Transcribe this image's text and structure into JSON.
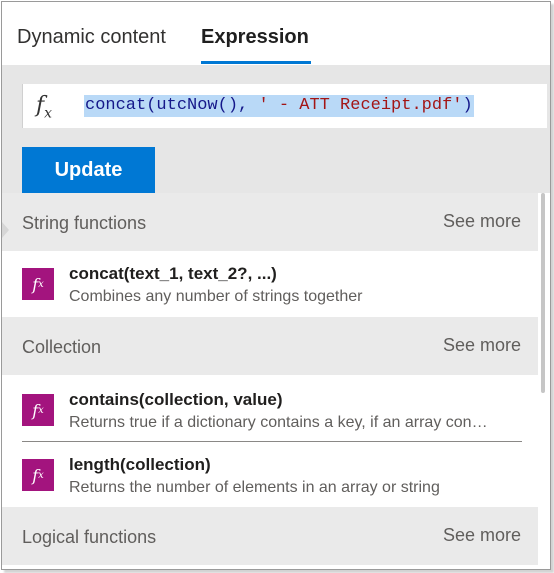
{
  "tabs": {
    "dynamic_content": "Dynamic content",
    "expression": "Expression",
    "active": "Expression"
  },
  "expression_editor": {
    "icon": "fx-icon",
    "value": "concat(utcNow(), ' - ATT Receipt.pdf')",
    "tokens": {
      "fn": "concat(utcNow(), ",
      "str": "' - ATT Receipt.pdf'",
      "close": ")"
    },
    "selected": true
  },
  "update_button": {
    "label": "Update"
  },
  "sections": [
    {
      "title": "String functions",
      "see_more": "See more",
      "items": [
        {
          "name": "concat(text_1, text_2?, ...)",
          "description": "Combines any number of strings together"
        }
      ]
    },
    {
      "title": "Collection",
      "see_more": "See more",
      "items": [
        {
          "name": "contains(collection, value)",
          "description": "Returns true if a dictionary contains a key, if an array con…"
        },
        {
          "name": "length(collection)",
          "description": "Returns the number of elements in an array or string"
        }
      ]
    },
    {
      "title": "Logical functions",
      "see_more": "See more",
      "items": []
    }
  ],
  "colors": {
    "accent": "#0078d4",
    "function_icon": "#a3147e",
    "selection": "#b9d9f7",
    "panel_gray": "#e6e6e6"
  }
}
